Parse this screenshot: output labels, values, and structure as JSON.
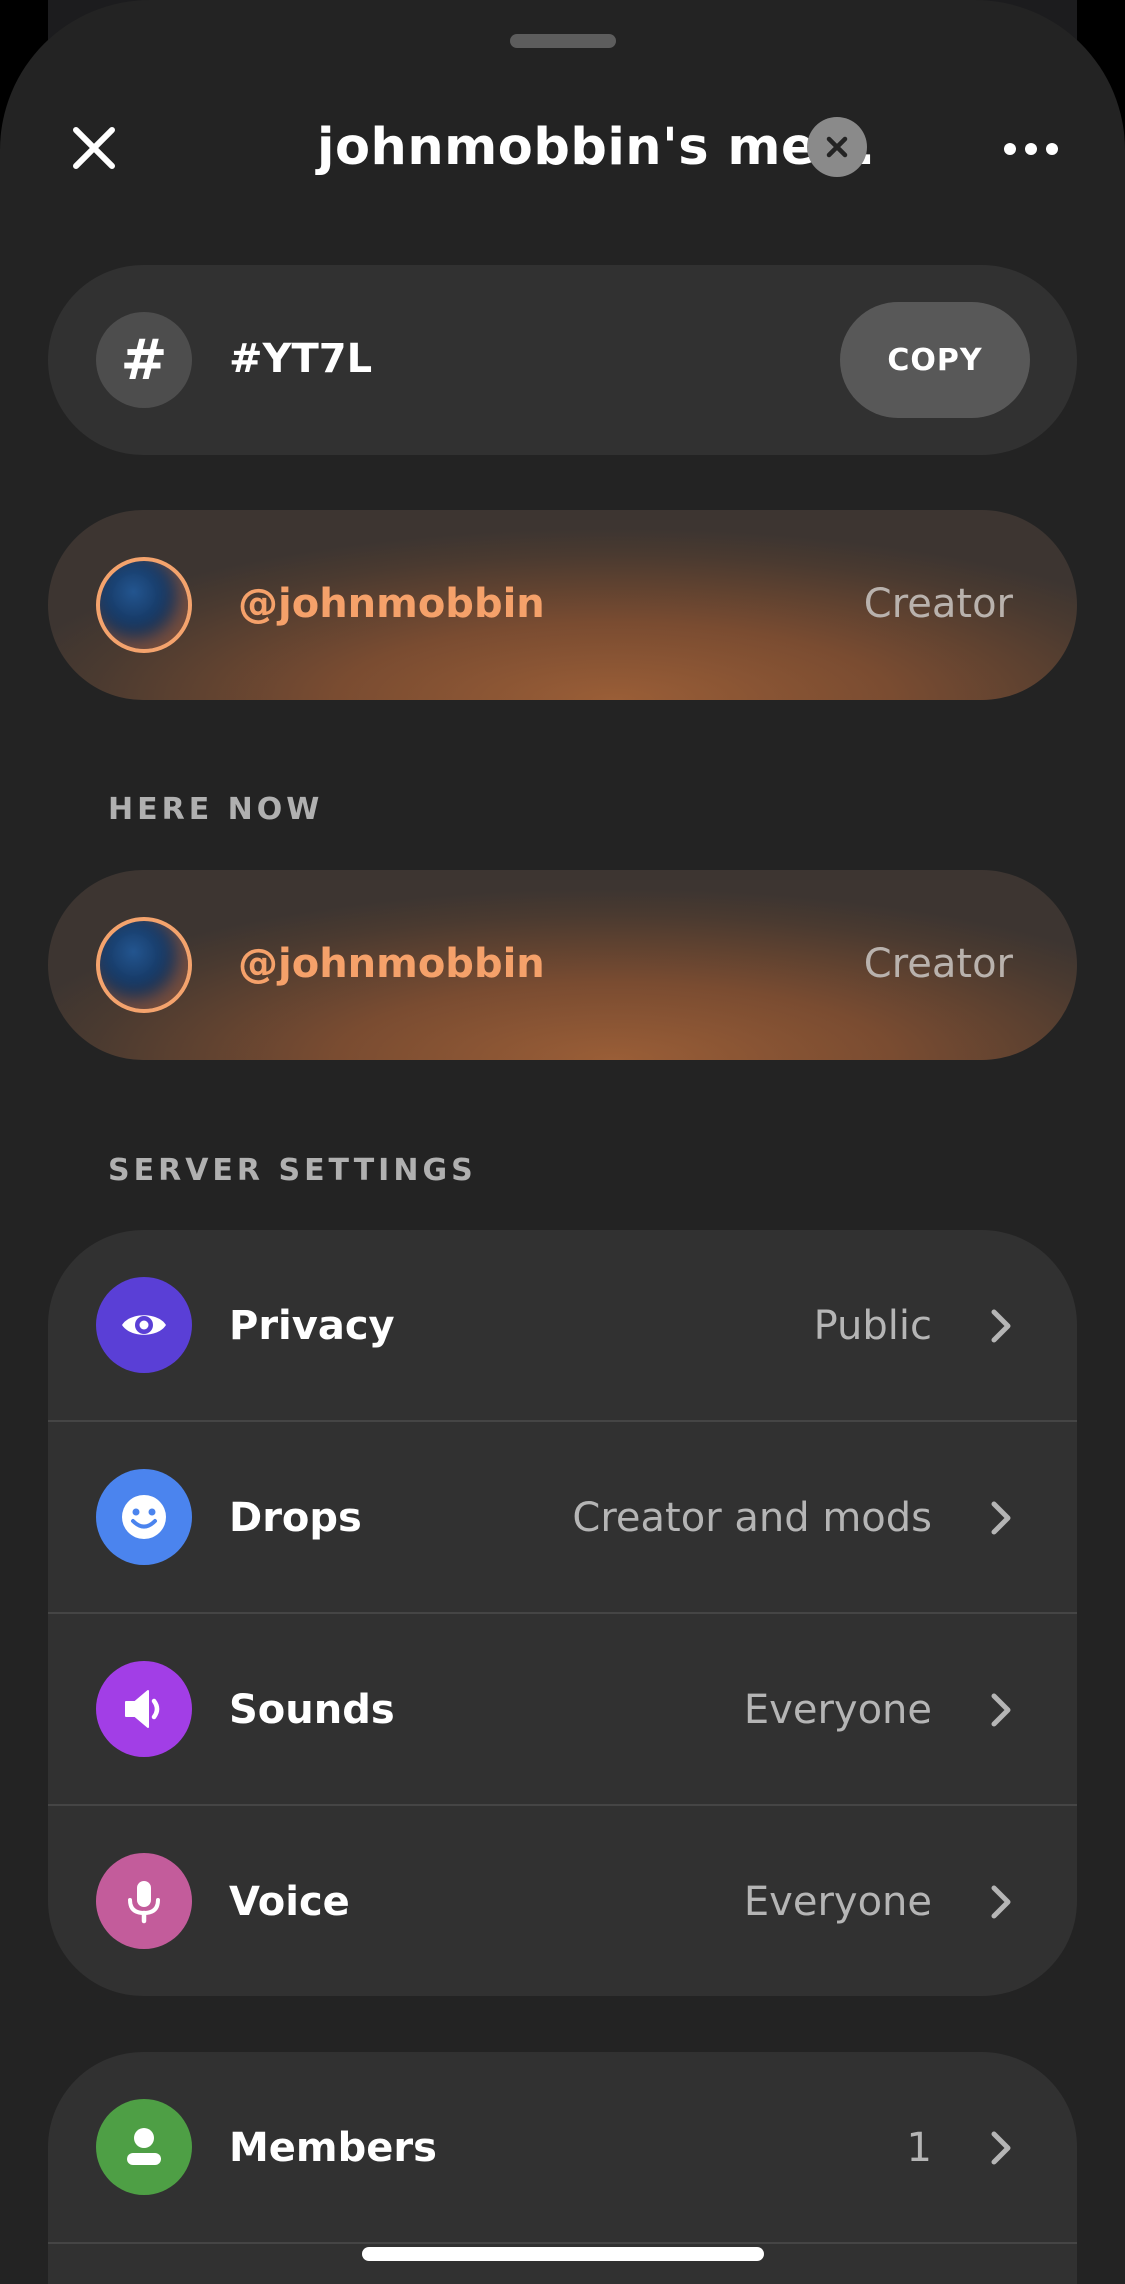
{
  "header": {
    "title": "johnmobbin's me...",
    "close_icon": "close-icon",
    "clear_icon": "clear-circle-icon",
    "more_icon": "more-horizontal-icon"
  },
  "code": {
    "icon": "#",
    "value": "#YT7L",
    "copy_label": "COPY"
  },
  "creator": {
    "username": "@johnmobbin",
    "role": "Creator"
  },
  "here_now": {
    "label": "HERE NOW",
    "users": [
      {
        "username": "@johnmobbin",
        "role": "Creator"
      }
    ]
  },
  "server_settings": {
    "label": "SERVER SETTINGS",
    "items": [
      {
        "label": "Privacy",
        "value": "Public",
        "icon": "eye-icon",
        "color": "#5a3fd6"
      },
      {
        "label": "Drops",
        "value": "Creator and mods",
        "icon": "smiley-icon",
        "color": "#4b84ee"
      },
      {
        "label": "Sounds",
        "value": "Everyone",
        "icon": "speaker-icon",
        "color": "#a23ee6"
      },
      {
        "label": "Voice",
        "value": "Everyone",
        "icon": "microphone-icon",
        "color": "#c35c9b"
      }
    ]
  },
  "members": {
    "label": "Members",
    "value": "1",
    "icon": "person-icon",
    "color": "#4e9f45"
  },
  "colors": {
    "background": "#232323",
    "card": "#313131",
    "accent_orange": "#f5a16a"
  }
}
